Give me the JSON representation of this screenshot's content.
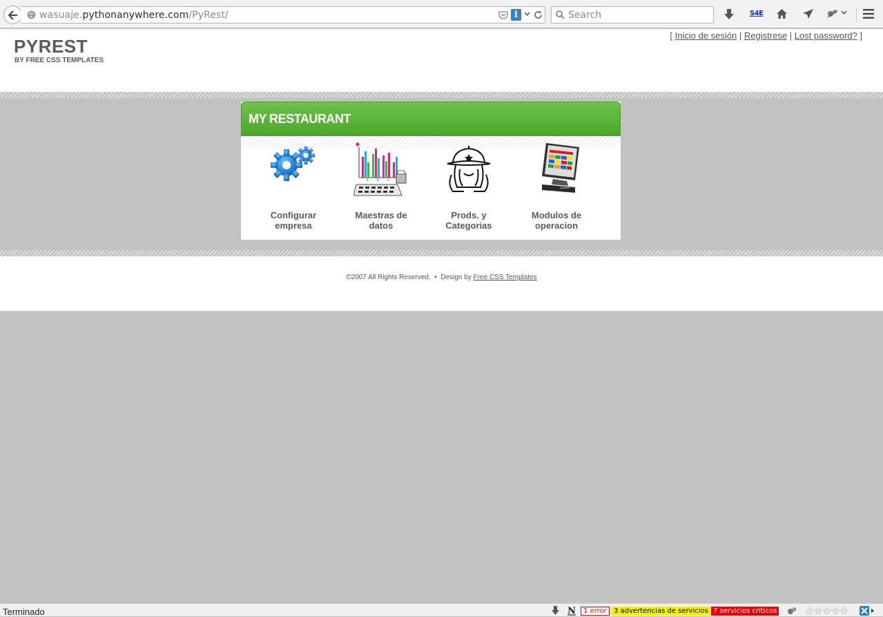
{
  "browser": {
    "url_prefix": "wasuaje.",
    "url_host": "pythonanywhere.com",
    "url_path": "/PyRest/",
    "search_placeholder": "Search",
    "s4e_label": "S4E"
  },
  "header": {
    "title": "PYREST",
    "subtitle": "BY FREE CSS TEMPLATES",
    "links": {
      "open": "[",
      "login": "Inicio de sesión",
      "sep1": "|",
      "register": "Registrese",
      "sep2": "|",
      "lost_password": "Lost password?",
      "close": "]"
    }
  },
  "panel": {
    "title": "MY RESTAURANT",
    "items": [
      {
        "line1": "Configurar",
        "line2": "empresa",
        "icon": "gears-icon"
      },
      {
        "line1": "Maestras de",
        "line2": "datos",
        "icon": "chart-calculator-icon"
      },
      {
        "line1": "Prods. y",
        "line2": "Categorias",
        "icon": "chef-icon"
      },
      {
        "line1": "Modulos de",
        "line2": "operacion",
        "icon": "pos-terminal-icon"
      }
    ]
  },
  "footer": {
    "text": "©2007 All Rights Reserved.  •  Design by ",
    "link": "Free CSS Templates"
  },
  "statusbar": {
    "status": "Terminado",
    "error": "1 error",
    "warnings": "3 advertencias de servicios",
    "critical": "7 servicios críticos",
    "stars": "☆☆☆☆☆"
  },
  "colors": {
    "panel_green": "#5db83a",
    "page_grey": "#c2c2c2",
    "text_grey": "#5a5a5a"
  }
}
